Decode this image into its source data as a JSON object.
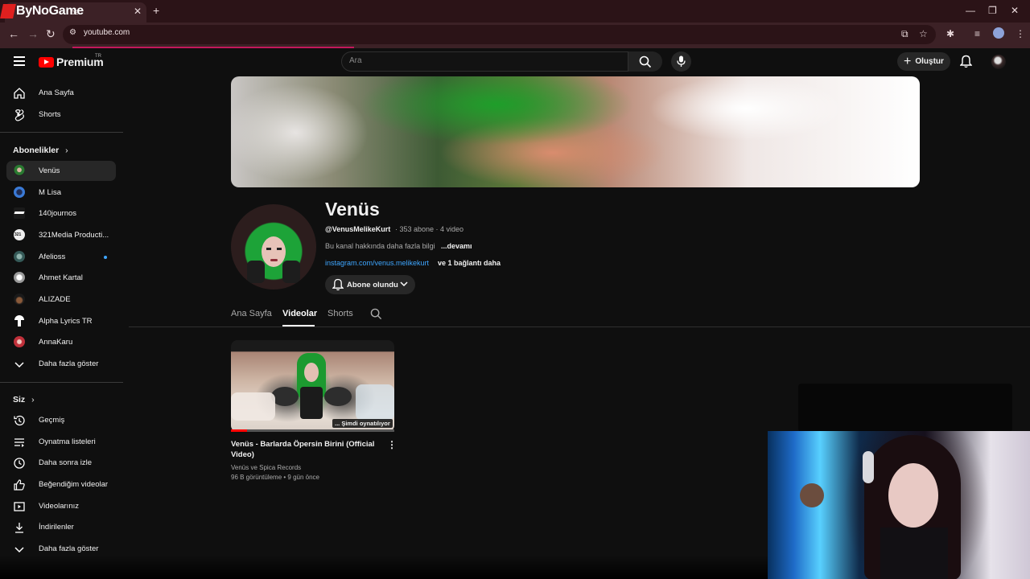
{
  "browser": {
    "overlay_logo": "ByNoGame",
    "tab_title": "be",
    "url": "youtube.com"
  },
  "header": {
    "logo_text": "Premium",
    "region": "TR",
    "search_placeholder": "Ara",
    "create_label": "Oluştur"
  },
  "sidebar": {
    "main": [
      {
        "label": "Ana Sayfa",
        "icon": "home-icon"
      },
      {
        "label": "Shorts",
        "icon": "shorts-icon"
      }
    ],
    "subscriptions_heading": "Abonelikler",
    "subscriptions": [
      {
        "label": "Venüs",
        "color": "#3a5b2a",
        "active": true
      },
      {
        "label": "M Lisa",
        "color": "#2f5f9e"
      },
      {
        "label": "140journos",
        "color": "#222222"
      },
      {
        "label": "321Media Producti...",
        "color": "#e8e8e8"
      },
      {
        "label": "Afelioss",
        "color": "#4a6b6a",
        "dot": true
      },
      {
        "label": "Ahmet Kartal",
        "color": "#bcbcbc"
      },
      {
        "label": "ALIZADE",
        "color": "#5a3a2a"
      },
      {
        "label": "Alpha Lyrics TR",
        "color": "#ffffff"
      },
      {
        "label": "AnnaKaru",
        "color": "#c8424a"
      }
    ],
    "show_more": "Daha fazla göster",
    "you_heading": "Siz",
    "you": [
      {
        "label": "Geçmiş",
        "icon": "history-icon"
      },
      {
        "label": "Oynatma listeleri",
        "icon": "playlists-icon"
      },
      {
        "label": "Daha sonra izle",
        "icon": "watch-later-icon"
      },
      {
        "label": "Beğendiğim videolar",
        "icon": "like-icon"
      },
      {
        "label": "Videolarınız",
        "icon": "your-videos-icon"
      },
      {
        "label": "İndirilenler",
        "icon": "download-icon"
      }
    ],
    "show_more_2": "Daha fazla göster"
  },
  "channel": {
    "name": "Venüs",
    "handle": "@VenusMelikeKurt",
    "meta": "· 353 abone · 4 video",
    "description": "Bu kanal hakkında daha fazla bilgi",
    "more": "...devamı",
    "link": "instagram.com/venus.melikekurt",
    "link_more": "ve 1 bağlantı daha",
    "subscribe_label": "Abone olundu",
    "tabs": [
      "Ana Sayfa",
      "Videolar",
      "Shorts"
    ],
    "active_tab": "Videolar"
  },
  "video": {
    "title": "Venüs - Barlarda Öpersin Birini (Official Video)",
    "now_playing": "... Şimdi oynatılıyor",
    "channel": "Venüs ve Spica Records",
    "stats": "96 B görüntüleme • 9 gün önce",
    "progress": 0.1
  }
}
